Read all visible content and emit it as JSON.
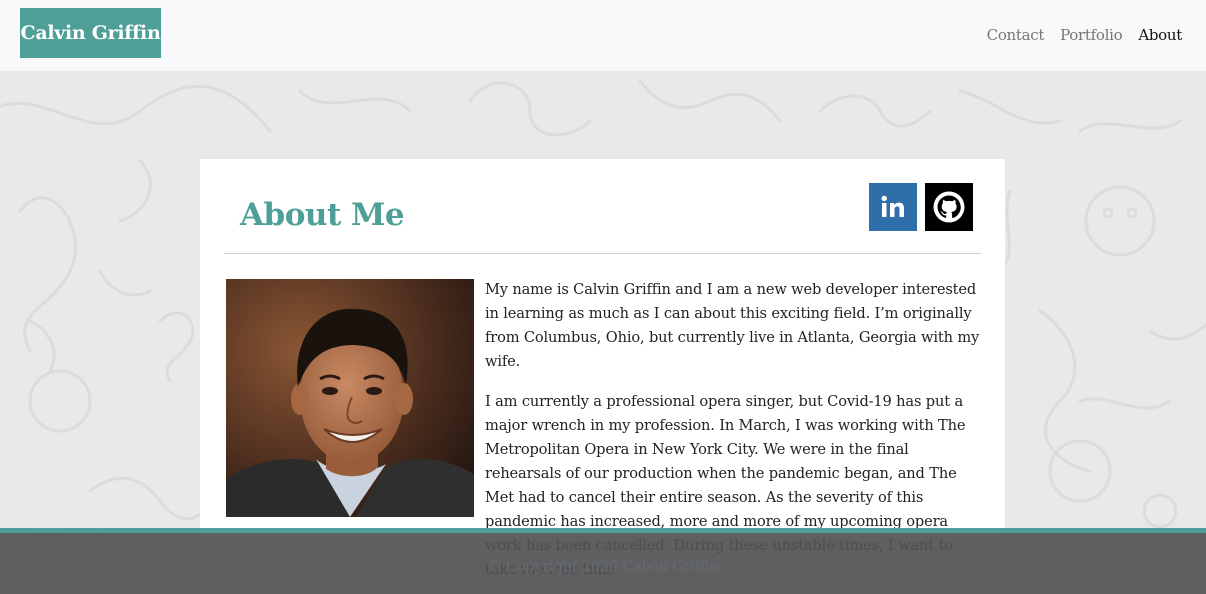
{
  "navbar": {
    "brand": "Calvin Griffin",
    "links": [
      {
        "label": "Contact"
      },
      {
        "label": "Portfolio"
      },
      {
        "label": "About"
      }
    ]
  },
  "about": {
    "title": "About Me",
    "paragraphs": [
      "My name is Calvin Griffin and I am a new web developer interested in learning as much as I can about this exciting field. I’m originally from Columbus, Ohio, but currently live in Atlanta, Georgia with my wife.",
      "I am currently a professional opera singer, but Covid-19 has put a major wrench in my profession. In March, I was working with The Metropolitan Opera in New York City. We were in the final rehearsals of our production when the pandemic began, and The Met had to cancel their entire season. As the severity of this pandemic has increased, more and more of my upcoming opera work has been cancelled. During these unstable times, I want to take the free time"
    ],
    "social": [
      {
        "name": "linkedin-icon",
        "label": "in"
      },
      {
        "name": "github-icon"
      }
    ]
  },
  "footer": {
    "copyright": "© Copyright 2020 Calvin Griffin"
  },
  "colors": {
    "accent": "#4f9f99",
    "linkedin": "#2f6fa9",
    "github": "#000000",
    "footer": "#525252"
  }
}
